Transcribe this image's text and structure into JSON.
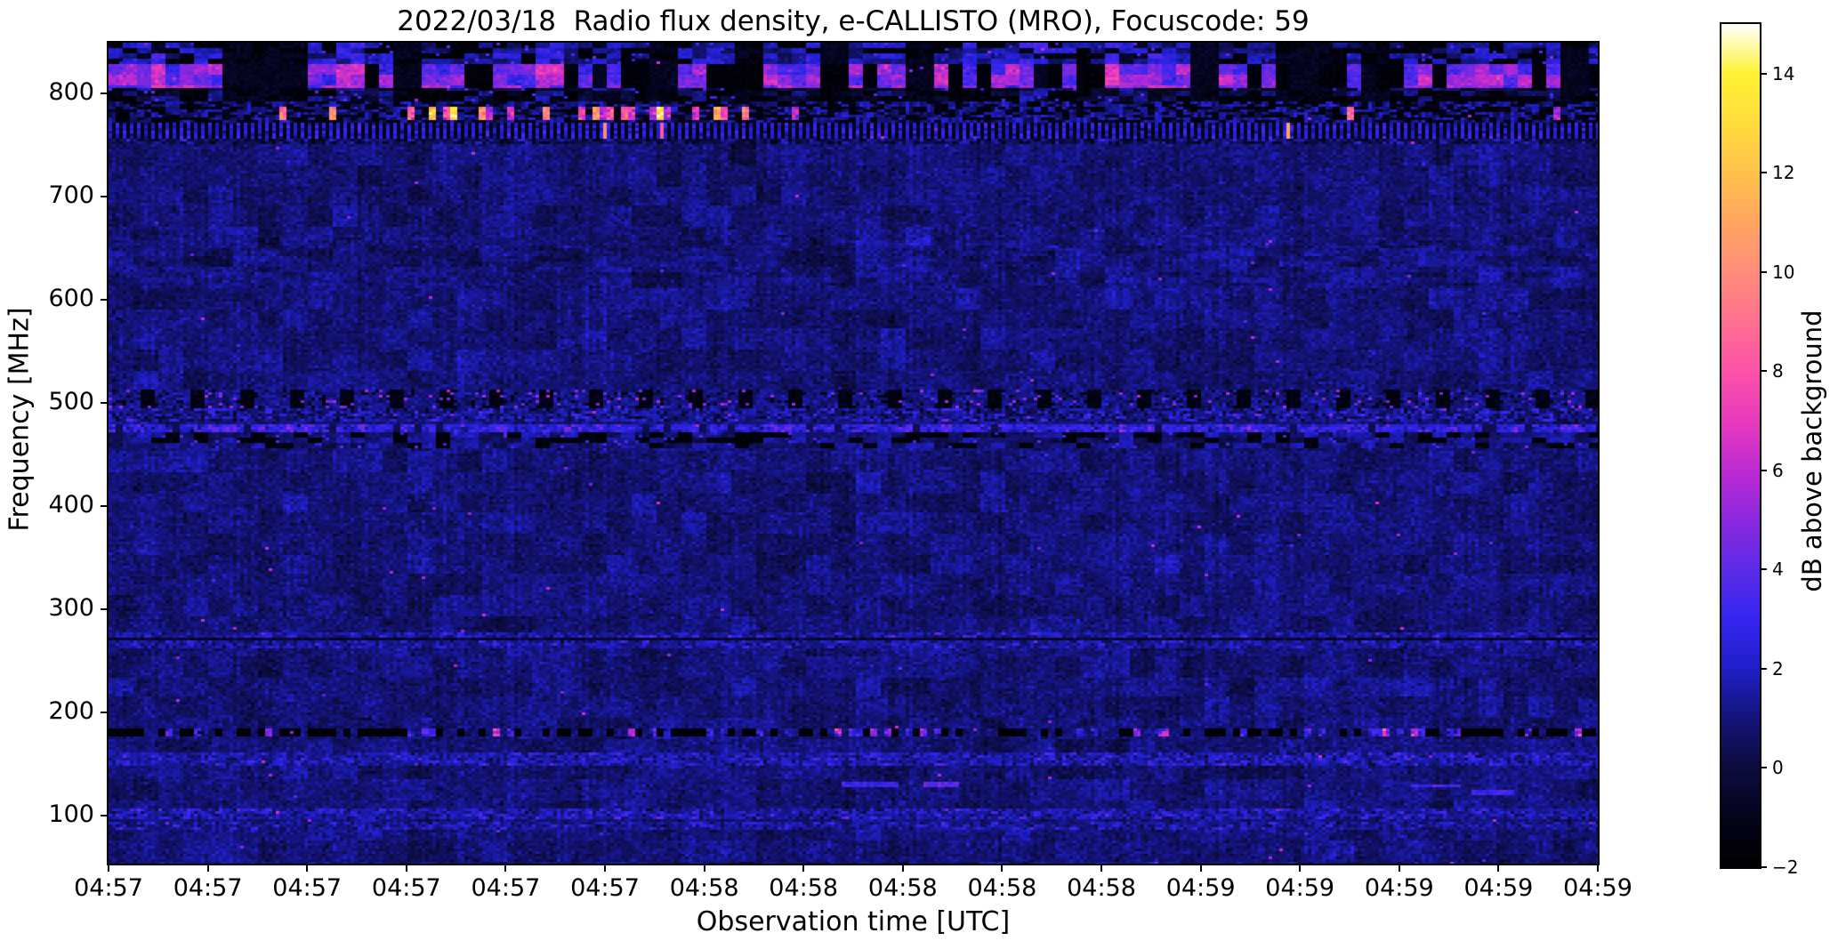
{
  "chart_data": {
    "type": "heatmap",
    "title": "2022/03/18  Radio flux density, e-CALLISTO (MRO), Focuscode: 59",
    "xlabel": "Observation time [UTC]",
    "ylabel": "Frequency [MHz]",
    "x_tick_labels": [
      "04:57",
      "04:57",
      "04:57",
      "04:57",
      "04:57",
      "04:57",
      "04:58",
      "04:58",
      "04:58",
      "04:58",
      "04:58",
      "04:59",
      "04:59",
      "04:59",
      "04:59",
      "04:59"
    ],
    "y_tick_values": [
      800,
      700,
      600,
      500,
      400,
      300,
      200,
      100
    ],
    "y_axis_range_mhz": [
      53.4,
      849.1
    ],
    "x_axis_range_utc": [
      "04:57",
      "04:59"
    ],
    "grid": false,
    "colorbar": {
      "label": "dB above background",
      "tick_values": [
        14,
        12,
        10,
        8,
        6,
        4,
        2,
        0,
        -2
      ],
      "tick_labels": [
        "14",
        "12",
        "10",
        "8",
        "6",
        "4",
        "2",
        "0",
        "−2"
      ],
      "value_range": [
        -2,
        15
      ],
      "colormap_stops": [
        [
          -2,
          "#000000"
        ],
        [
          -1,
          "#04041c"
        ],
        [
          0,
          "#0c0c3e"
        ],
        [
          1,
          "#14147a"
        ],
        [
          2,
          "#1f1fc8"
        ],
        [
          3,
          "#3525ee"
        ],
        [
          4,
          "#5c2be8"
        ],
        [
          5,
          "#8c28dd"
        ],
        [
          6,
          "#bd2bd2"
        ],
        [
          7,
          "#e83abc"
        ],
        [
          8,
          "#fc52a8"
        ],
        [
          9,
          "#ff7090"
        ],
        [
          10,
          "#ff8d7a"
        ],
        [
          11,
          "#ffa660"
        ],
        [
          12,
          "#ffc14b"
        ],
        [
          13,
          "#ffdc3c"
        ],
        [
          14,
          "#fff233"
        ],
        [
          15,
          "#ffffff"
        ]
      ]
    },
    "background_db": {
      "mean": 0.9,
      "sigma": 0.42
    },
    "features": [
      {
        "name": "top-mottle-rfi",
        "f_hi": 852,
        "f_lo": 829,
        "style": "mottle",
        "base": 0.3,
        "range": 2.4,
        "dark_frac": 0.32
      },
      {
        "name": "lte-patch-band",
        "f_hi": 829,
        "f_lo": 806,
        "style": "patches",
        "base": 2.8,
        "range": 3.6,
        "gap_frac": 0.3
      },
      {
        "name": "dark-speckle-band",
        "f_hi": 806,
        "f_lo": 791,
        "style": "mottle",
        "base": -0.7,
        "range": 2.0,
        "dark_frac": 0.55
      },
      {
        "name": "burst-band-780",
        "f_hi": 791,
        "f_lo": 772,
        "style": "bursts",
        "cx0": 0.17,
        "cx1": 0.43,
        "p1": 0.38,
        "p0": 0.045
      },
      {
        "name": "comb-band-763",
        "f_hi": 772,
        "f_lo": 756,
        "style": "comb",
        "on": 2.3,
        "off": -0.9,
        "hot_prob": 0.012,
        "hot": 7.5
      },
      {
        "name": "comb-edge-753",
        "f_hi": 756,
        "f_lo": 750,
        "style": "speckle",
        "base": 0.2,
        "sigma": 0.9
      },
      {
        "name": "faint-texture-640",
        "f_hi": 660,
        "f_lo": 615,
        "style": "texture",
        "delta": 0.3
      },
      {
        "name": "periodic-dark-505",
        "f_hi": 512,
        "f_lo": 494,
        "style": "periodic",
        "period": 56,
        "duty": 0.3,
        "dark": -1.3,
        "lite": 1.1,
        "phase": 20
      },
      {
        "name": "speckle-488",
        "f_hi": 494,
        "f_lo": 483,
        "style": "speckle",
        "base": 1.0,
        "sigma": 0.9
      },
      {
        "name": "bright-line-476",
        "f_hi": 480,
        "f_lo": 472,
        "style": "brightline",
        "base": 2.5,
        "sigma": 0.8
      },
      {
        "name": "dark-band-462",
        "f_hi": 472,
        "f_lo": 455,
        "style": "mottle",
        "base": 0.1,
        "range": 1.8,
        "dark_frac": 0.25
      },
      {
        "name": "band-270",
        "f_hi": 278,
        "f_lo": 263,
        "style": "speckle",
        "base": 1.3,
        "sigma": 0.6
      },
      {
        "name": "dark-line-270",
        "f_hi": 272,
        "f_lo": 269,
        "style": "darkline",
        "base": -0.5,
        "sigma": 0.4
      },
      {
        "name": "dashed-line-180",
        "f_hi": 184,
        "f_lo": 177,
        "style": "dashline"
      },
      {
        "name": "speckle-155",
        "f_hi": 160,
        "f_lo": 149,
        "style": "speckle",
        "base": 1.5,
        "sigma": 0.7
      },
      {
        "name": "bright-dashes-130",
        "style": "segments",
        "segments": [
          {
            "x0": 0.492,
            "x1": 0.531,
            "f": 130,
            "db": 3.2
          },
          {
            "x0": 0.548,
            "x1": 0.571,
            "f": 131,
            "db": 3.8
          },
          {
            "x0": 0.875,
            "x1": 0.907,
            "f": 129,
            "db": 3.2
          },
          {
            "x0": 0.916,
            "x1": 0.943,
            "f": 122,
            "db": 3.0
          }
        ]
      },
      {
        "name": "band-100",
        "f_hi": 106,
        "f_lo": 97,
        "style": "speckle",
        "base": 1.5,
        "sigma": 0.7
      },
      {
        "name": "band-90",
        "f_hi": 94,
        "f_lo": 87,
        "style": "speckle",
        "base": 1.2,
        "sigma": 0.6
      }
    ]
  }
}
